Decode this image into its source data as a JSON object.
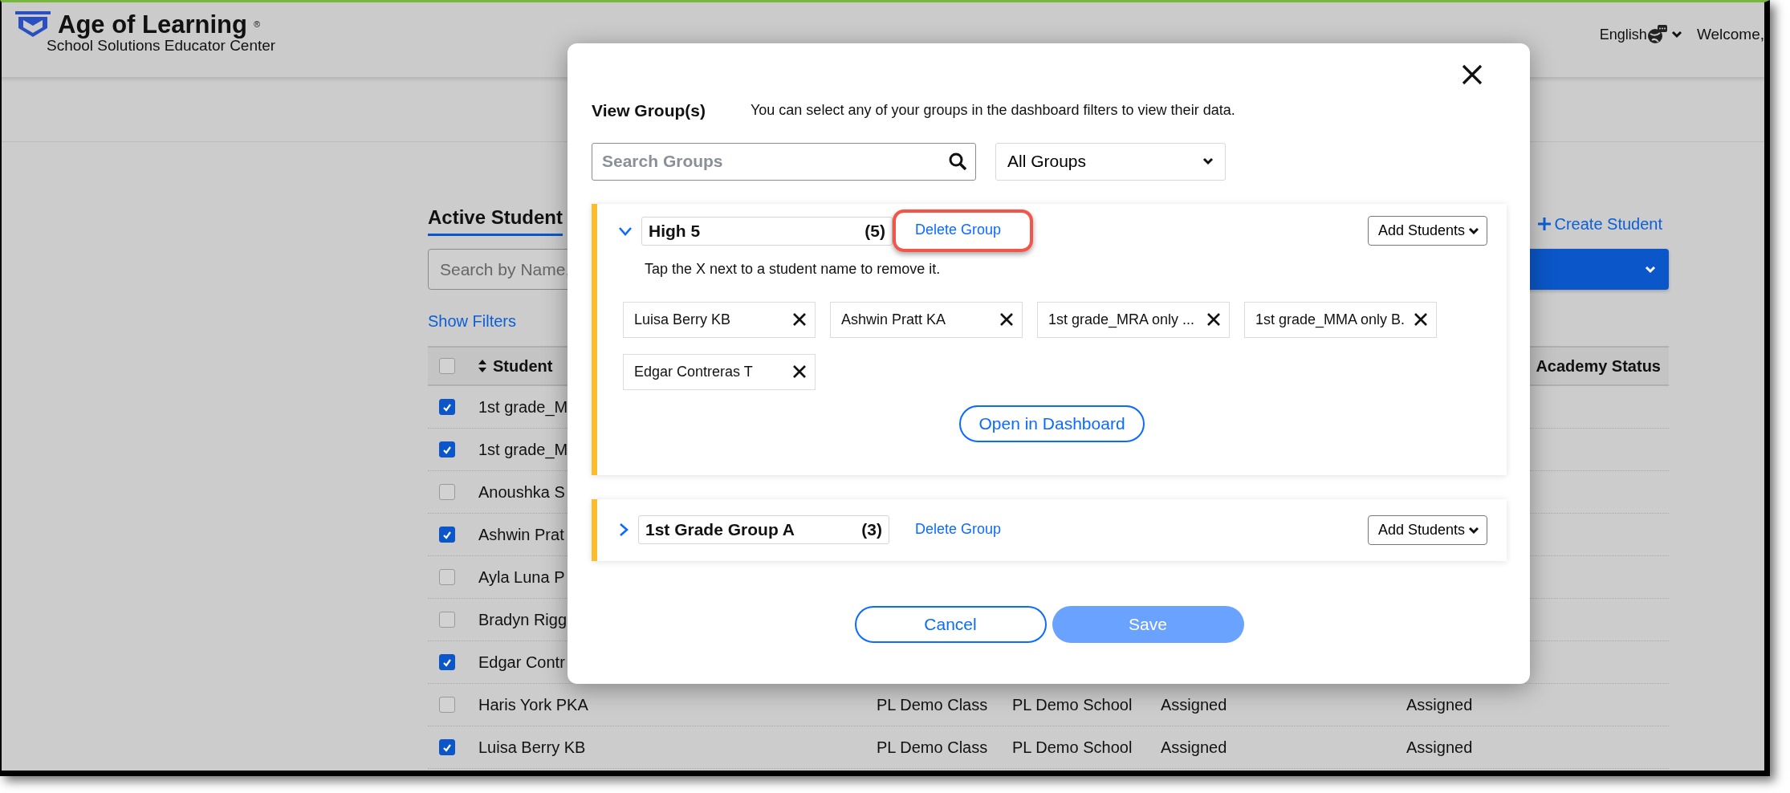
{
  "header": {
    "brand": "Age of Learning",
    "registered": "®",
    "subtitle": "School Solutions Educator Center",
    "language": "English",
    "welcome": "Welcome,"
  },
  "students": {
    "title": "Active Student",
    "create_label": "Create Student",
    "search_placeholder": "Search by Name,",
    "filters_link": "Show Filters",
    "select_all_checked": false,
    "columns": [
      "Student",
      "Academy Status"
    ],
    "rows": [
      {
        "checked": true,
        "name": "1st grade_M"
      },
      {
        "checked": true,
        "name": "1st grade_M"
      },
      {
        "checked": false,
        "name": "Anoushka S"
      },
      {
        "checked": true,
        "name": "Ashwin Prat"
      },
      {
        "checked": false,
        "name": "Ayla Luna P"
      },
      {
        "checked": false,
        "name": "Bradyn Rigg"
      },
      {
        "checked": true,
        "name": "Edgar Contr"
      },
      {
        "checked": false,
        "name": "Haris York PKA",
        "class": "PL Demo Class",
        "school": "PL Demo School",
        "status": "Assigned",
        "academy_status": "Assigned"
      },
      {
        "checked": true,
        "name": "Luisa Berry KB",
        "class": "PL Demo Class",
        "school": "PL Demo School",
        "status": "Assigned",
        "academy_status": "Assigned"
      }
    ]
  },
  "modal": {
    "title": "View Group(s)",
    "description": "You can select any of your groups in the dashboard filters to view their data.",
    "search_placeholder": "Search Groups",
    "filter": "All Groups",
    "groups": [
      {
        "expanded": true,
        "name": "High 5",
        "count": "(5)",
        "delete_label": "Delete Group",
        "highlighted": true,
        "add_label": "Add Students",
        "hint": "Tap the X next to a student name to remove it.",
        "members": [
          "Luisa Berry KB",
          "Ashwin Pratt KA",
          "1st grade_MRA only ...",
          "1st grade_MMA only B.",
          "Edgar Contreras T"
        ],
        "open_label": "Open in Dashboard"
      },
      {
        "expanded": false,
        "name": "1st Grade Group A",
        "count": "(3)",
        "delete_label": "Delete Group",
        "highlighted": false,
        "add_label": "Add Students"
      }
    ],
    "cancel_label": "Cancel",
    "save_label": "Save",
    "save_disabled": true
  }
}
